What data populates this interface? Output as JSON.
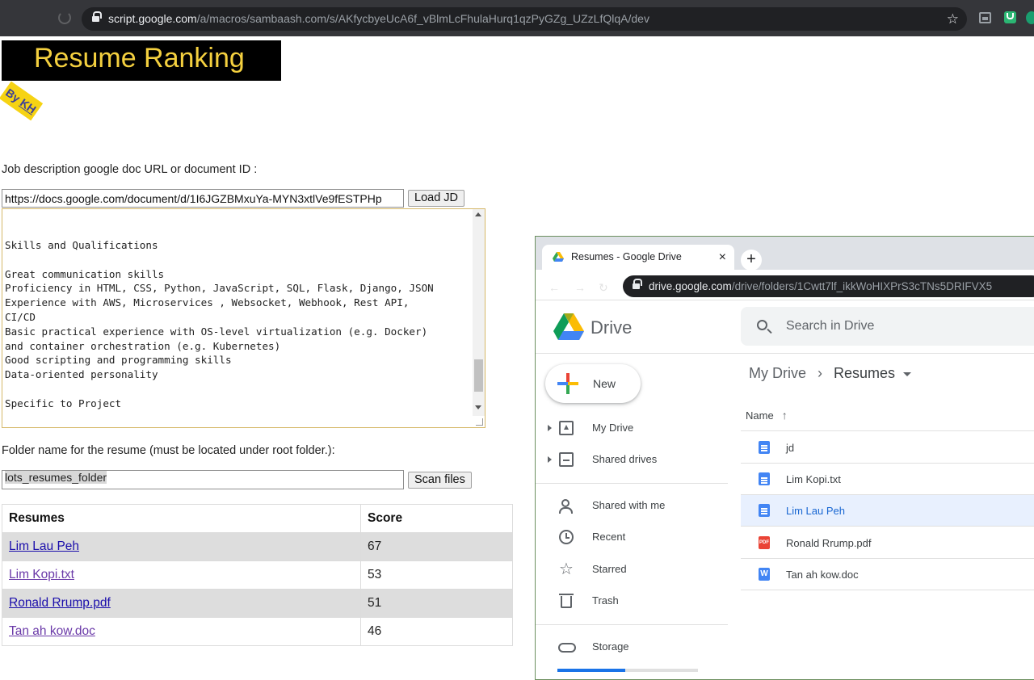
{
  "browser": {
    "url_host": "script.google.com",
    "url_path": "/a/macros/sambaash.com/s/AKfycbyeUcA6f_vBlmLcFhulaHurq1qzPyGZg_UZzLfQlqA/dev"
  },
  "app": {
    "title": "Resume Ranking",
    "badge_prefix": "By ",
    "badge_author": "KH"
  },
  "jd": {
    "label": "Job description google doc URL or document ID :",
    "url_value": "https://docs.google.com/document/d/1I6JGZBMxuYa-MYN3xtlVe9fESTPHp",
    "load_button": "Load JD",
    "text": "Skills and Qualifications\n\nGreat communication skills\nProficiency in HTML, CSS, Python, JavaScript, SQL, Flask, Django, JSON\nExperience with AWS, Microservices , Websocket, Webhook, Rest API,\nCI/CD\nBasic practical experience with OS-level virtualization (e.g. Docker)\nand container orchestration (e.g. Kubernetes)\nGood scripting and programming skills\nData-oriented personality\n\nSpecific to Project"
  },
  "folder": {
    "label": "Folder name for the resume (must be located under root folder.):",
    "value": "lots_resumes_folder",
    "scan_button": "Scan files"
  },
  "results": {
    "headers": [
      "Resumes",
      "Score"
    ],
    "rows": [
      {
        "name": "Lim Lau Peh",
        "score": "67"
      },
      {
        "name": "Lim Kopi.txt",
        "score": "53"
      },
      {
        "name": "Ronald Rrump.pdf",
        "score": "51"
      },
      {
        "name": "Tan ah kow.doc",
        "score": "46"
      }
    ]
  },
  "drive_window": {
    "tab_title": "Resumes - Google Drive",
    "tab_close": "×",
    "new_tab": "+",
    "url_host": "drive.google.com",
    "url_path": "/drive/folders/1Cwtt7lf_ikkWoHIXPrS3cTNs5DRIFVX5",
    "app_name": "Drive",
    "search_placeholder": "Search in Drive",
    "new_button": "New",
    "nav": {
      "my_drive": "My Drive",
      "shared_drives": "Shared drives",
      "shared_with_me": "Shared with me",
      "recent": "Recent",
      "starred": "Starred",
      "trash": "Trash",
      "storage": "Storage"
    },
    "storage_fraction": 0.48,
    "breadcrumb": {
      "root": "My Drive",
      "current": "Resumes"
    },
    "file_list_header": "Name",
    "files": [
      {
        "name": "jd",
        "type": "doc"
      },
      {
        "name": "Lim Kopi.txt",
        "type": "txt"
      },
      {
        "name": "Lim Lau Peh",
        "type": "doc"
      },
      {
        "name": "Ronald Rrump.pdf",
        "type": "pdf"
      },
      {
        "name": "Tan ah kow.doc",
        "type": "word"
      }
    ],
    "pdf_icon_text": "PDF",
    "word_icon_text": "W"
  },
  "colors": {
    "banner_bg": "#000000",
    "banner_text": "#f4d03f",
    "badge_bg": "#f6d313",
    "link": "#1a0dab",
    "link_visited": "#6a39a8",
    "selected_row": "#e8f0fe"
  }
}
